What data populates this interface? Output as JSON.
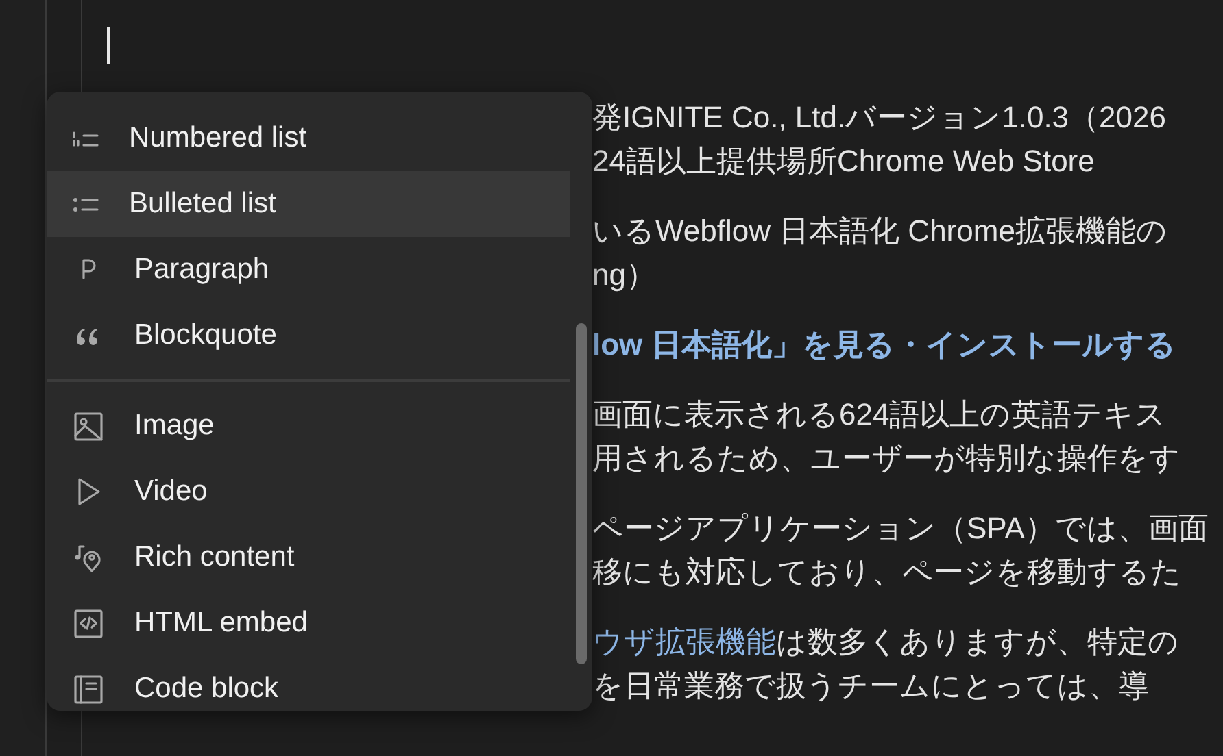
{
  "document": {
    "paragraphs": [
      {
        "kind": "text",
        "lines": [
          [
            {
              "kind": "plain",
              "text": "発IGNITE Co., Ltd.バージョン1.0.3（2026"
            }
          ],
          [
            {
              "kind": "plain",
              "text": "24語以上提供場所Chrome Web Store"
            }
          ]
        ]
      },
      {
        "kind": "text",
        "lines": [
          [
            {
              "kind": "plain",
              "text": "いるWebflow 日本語化 Chrome拡張機能の"
            }
          ],
          [
            {
              "kind": "plain",
              "text": "ng）"
            }
          ]
        ]
      },
      {
        "kind": "heading",
        "lines": [
          [
            {
              "kind": "link",
              "text": "low 日本語化」を見る・インストールする"
            }
          ]
        ]
      },
      {
        "kind": "text",
        "lines": [
          [
            {
              "kind": "plain",
              "text": "画面に表示される624語以上の英語テキス"
            }
          ],
          [
            {
              "kind": "plain",
              "text": "用されるため、ユーザーが特別な操作をす"
            }
          ]
        ]
      },
      {
        "kind": "text",
        "lines": [
          [
            {
              "kind": "plain",
              "text": "ページアプリケーション（SPA）では、画面"
            }
          ],
          [
            {
              "kind": "plain",
              "text": "移にも対応しており、ページを移動するた"
            }
          ]
        ]
      },
      {
        "kind": "text",
        "lines": [
          [
            {
              "kind": "link",
              "text": "ウザ拡張機能"
            },
            {
              "kind": "plain",
              "text": "は数多くありますが、特定の"
            }
          ],
          [
            {
              "kind": "plain",
              "text": "を日常業務で扱うチームにとっては、導"
            }
          ]
        ]
      }
    ]
  },
  "insert_menu": {
    "groups": [
      [
        {
          "kind": "numbered",
          "label": "Numbered list",
          "selected": false
        },
        {
          "kind": "bulleted",
          "label": "Bulleted list",
          "selected": true
        },
        {
          "kind": "paragraph",
          "label": "Paragraph",
          "selected": false
        },
        {
          "kind": "quote",
          "label": "Blockquote",
          "selected": false
        }
      ],
      [
        {
          "kind": "image",
          "label": "Image",
          "selected": false
        },
        {
          "kind": "video",
          "label": "Video",
          "selected": false
        },
        {
          "kind": "rich",
          "label": "Rich content",
          "selected": false
        },
        {
          "kind": "embed",
          "label": "HTML embed",
          "selected": false
        },
        {
          "kind": "code",
          "label": "Code block",
          "selected": false
        }
      ]
    ]
  }
}
